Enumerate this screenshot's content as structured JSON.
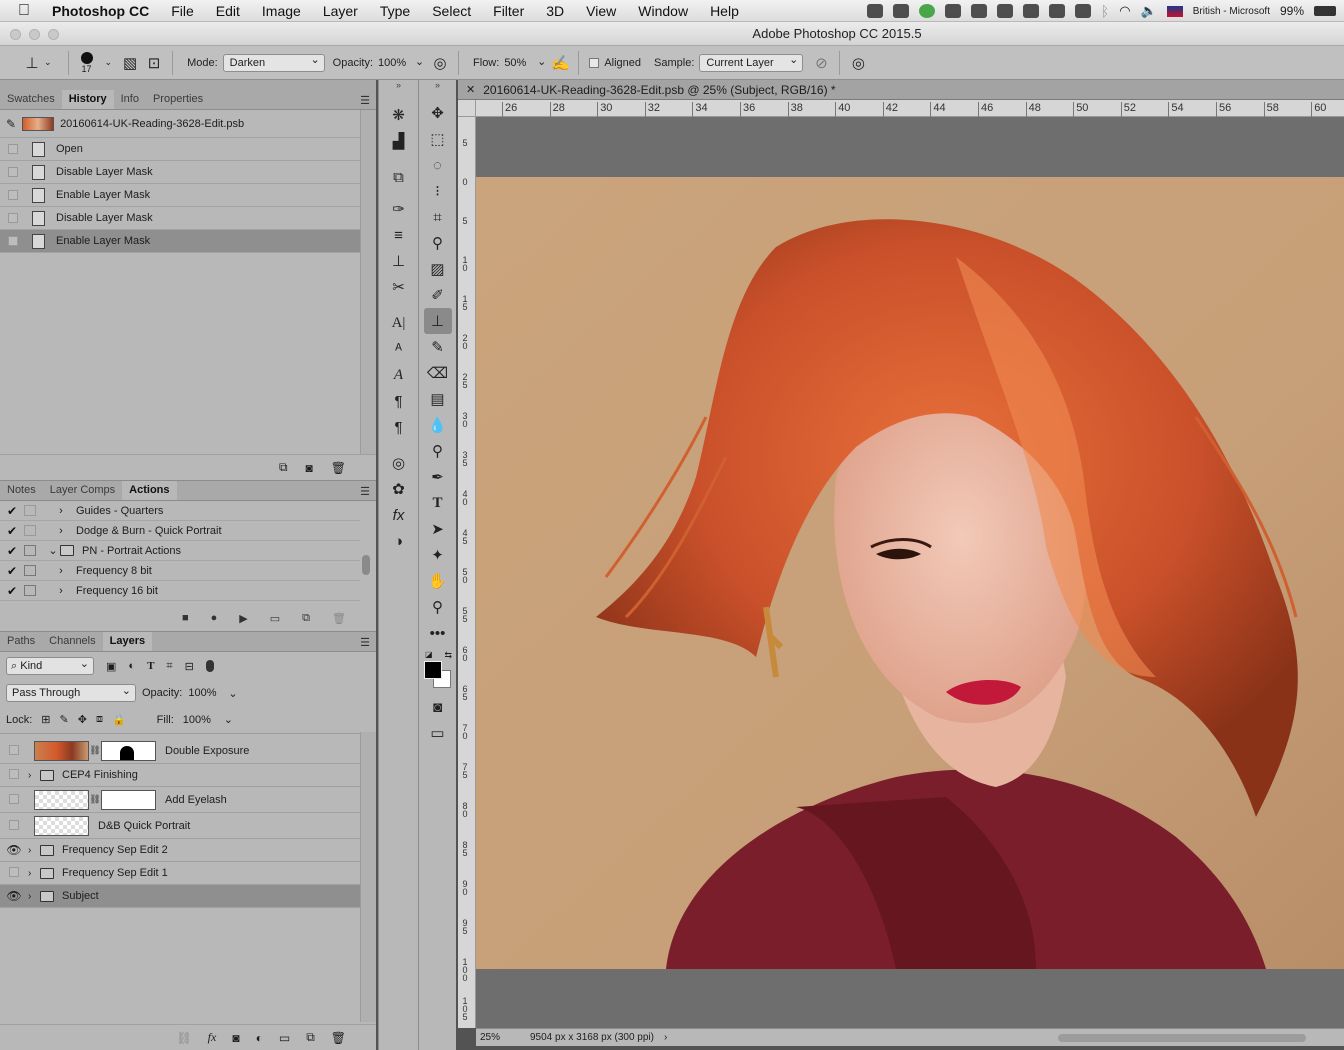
{
  "menubar": {
    "app": "Photoshop CC",
    "items": [
      "File",
      "Edit",
      "Image",
      "Layer",
      "Type",
      "Select",
      "Filter",
      "3D",
      "View",
      "Window",
      "Help"
    ],
    "keyboard": "British - Microsoft",
    "battery": "99%"
  },
  "window": {
    "title": "Adobe Photoshop CC 2015.5"
  },
  "options": {
    "brush_size": "17",
    "mode_label": "Mode:",
    "mode_value": "Darken",
    "opacity_label": "Opacity:",
    "opacity_value": "100%",
    "flow_label": "Flow:",
    "flow_value": "50%",
    "aligned_label": "Aligned",
    "sample_label": "Sample:",
    "sample_value": "Current Layer"
  },
  "history_panel": {
    "tabs": [
      "Swatches",
      "History",
      "Info",
      "Properties"
    ],
    "active_tab": "History",
    "snapshot_name": "20160614-UK-Reading-3628-Edit.psb",
    "states": [
      "Open",
      "Disable Layer Mask",
      "Enable Layer Mask",
      "Disable Layer Mask",
      "Enable Layer Mask"
    ]
  },
  "actions_panel": {
    "tabs": [
      "Notes",
      "Layer Comps",
      "Actions"
    ],
    "active_tab": "Actions",
    "items": [
      {
        "name": "Guides - Quarters",
        "check": "✔"
      },
      {
        "name": "Dodge & Burn - Quick Portrait",
        "check": "✔"
      },
      {
        "name": "PN - Portrait Actions",
        "check": "✔"
      },
      {
        "name": "Frequency 8 bit",
        "check": "✔"
      },
      {
        "name": "Frequency 16 bit",
        "check": "✔"
      }
    ]
  },
  "layers_panel": {
    "tabs": [
      "Paths",
      "Channels",
      "Layers"
    ],
    "active_tab": "Layers",
    "filter_kind": "Kind",
    "blend_mode": "Pass Through",
    "opacity_label": "Opacity:",
    "opacity_value": "100%",
    "lock_label": "Lock:",
    "fill_label": "Fill:",
    "fill_value": "100%",
    "layers": [
      {
        "name": "Double Exposure",
        "visible": false
      },
      {
        "name": "CEP4 Finishing",
        "visible": false
      },
      {
        "name": "Add Eyelash",
        "visible": false
      },
      {
        "name": "D&B Quick Portrait",
        "visible": false
      },
      {
        "name": "Frequency Sep Edit 2",
        "visible": true
      },
      {
        "name": "Frequency Sep Edit 1",
        "visible": false
      },
      {
        "name": "Subject",
        "visible": true
      }
    ]
  },
  "document": {
    "tab_title": "20160614-UK-Reading-3628-Edit.psb @ 25% (Subject, RGB/16) *",
    "ruler_h": [
      "26",
      "28",
      "30",
      "32",
      "34",
      "36",
      "38",
      "40",
      "42",
      "44",
      "46",
      "48",
      "50",
      "52",
      "54",
      "56",
      "58",
      "60"
    ],
    "ruler_v": [
      "5",
      "0",
      "5",
      "1\n0",
      "1\n5",
      "2\n0",
      "2\n5",
      "3\n0",
      "3\n5",
      "4\n0",
      "4\n5",
      "5\n0",
      "5\n5",
      "6\n0",
      "6\n5",
      "7\n0",
      "7\n5",
      "8\n0",
      "8\n5",
      "9\n0",
      "9\n5",
      "1\n0\n0",
      "1\n0\n5"
    ],
    "zoom": "25%",
    "doc_info": "9504 px x 3168 px (300 ppi)"
  },
  "colors": {
    "background_canvas": "#c8a27a",
    "hair": "#d2582a",
    "shirt": "#7a1e2b",
    "lips": "#c2193a"
  }
}
